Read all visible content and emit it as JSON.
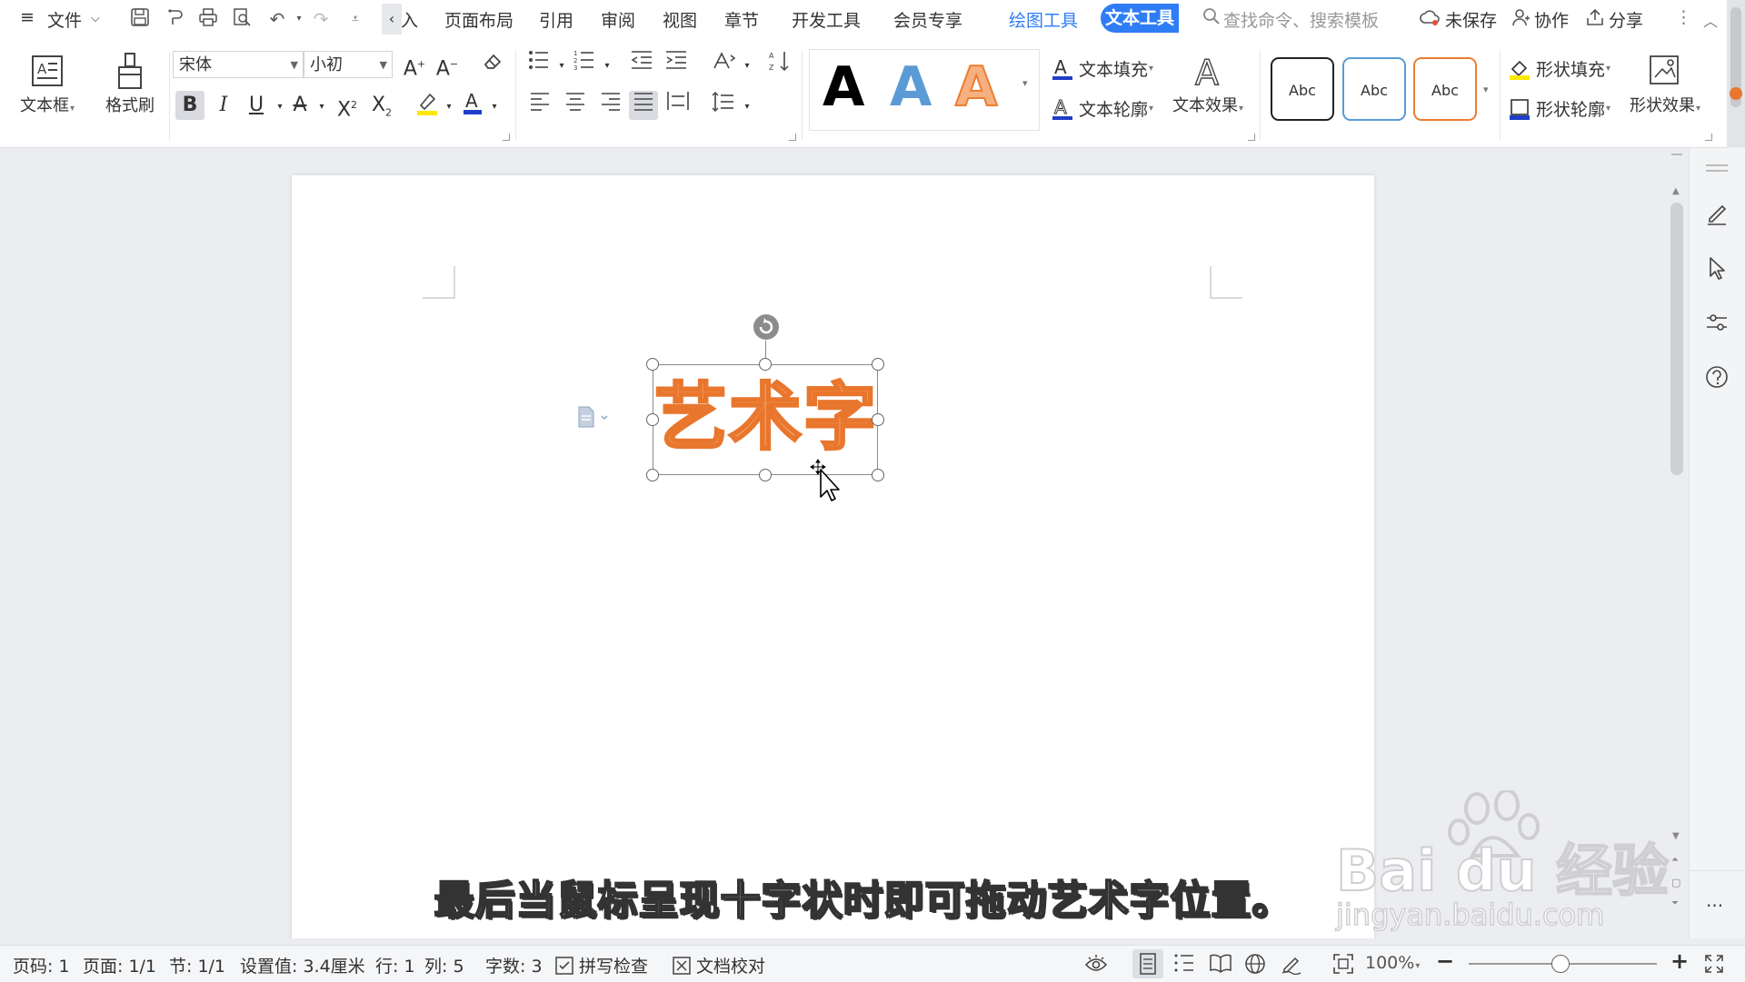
{
  "menubar": {
    "hamburger": "≡",
    "file_label": "文件",
    "tabs": [
      "页面布局",
      "引用",
      "审阅",
      "视图",
      "章节",
      "开发工具",
      "会员专享"
    ],
    "partial_tab": "入",
    "draw_tools": "绘图工具",
    "text_tools": "文本工具",
    "search_placeholder": "查找命令、搜索模板",
    "unsaved": "未保存",
    "collab": "协作",
    "share": "分享"
  },
  "ribbon": {
    "textbox": "文本框",
    "format_painter": "格式刷",
    "font_name": "宋体",
    "font_size": "小初",
    "text_fill": "文本填充",
    "text_outline": "文本轮廓",
    "text_effect": "文本效果",
    "shape_fill": "形状填充",
    "shape_outline": "形状轮廓",
    "shape_effect": "形状效果",
    "style_letter": "A",
    "abc": "Abc",
    "colors": {
      "accent_blue": "#2f7df6",
      "style_black": "#000000",
      "style_blue": "#5b9bd5",
      "style_orange": "#ed7d31"
    }
  },
  "document": {
    "wordart": "艺术字",
    "subtitle": "最后当鼠标呈现十字状时即可拖动艺术字位置。",
    "watermark_top": "Bai du 经验",
    "watermark_bottom": "jingyan.baidu.com"
  },
  "statusbar": {
    "page_no": "页码: 1",
    "pages": "页面: 1/1",
    "section": "节: 1/1",
    "setting": "设置值: 3.4厘米",
    "row": "行: 1",
    "col": "列: 5",
    "words": "字数: 3",
    "spell": "拼写检查",
    "proof": "文档校对",
    "zoom": "100%"
  }
}
